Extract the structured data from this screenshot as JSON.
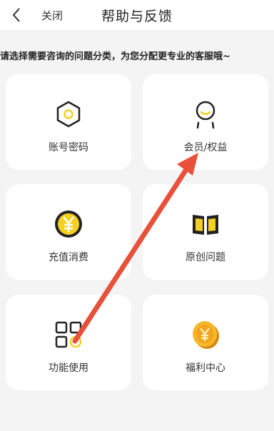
{
  "header": {
    "close_label": "关闭",
    "title": "帮助与反馈"
  },
  "subtitle": "请选择需要咨询的问题分类，为您分配更专业的客服哦~",
  "categories": [
    {
      "label": "账号密码",
      "icon": "hexagon-icon"
    },
    {
      "label": "会员/权益",
      "icon": "member-icon"
    },
    {
      "label": "充值消费",
      "icon": "yen-coin-icon"
    },
    {
      "label": "原创问题",
      "icon": "open-book-icon"
    },
    {
      "label": "功能使用",
      "icon": "grid-apps-icon"
    },
    {
      "label": "福利中心",
      "icon": "gold-coin-icon"
    }
  ],
  "colors": {
    "accent": "#f5d020",
    "annotation_arrow": "#e8503a",
    "background": "#f4f4f4",
    "card": "#ffffff"
  }
}
